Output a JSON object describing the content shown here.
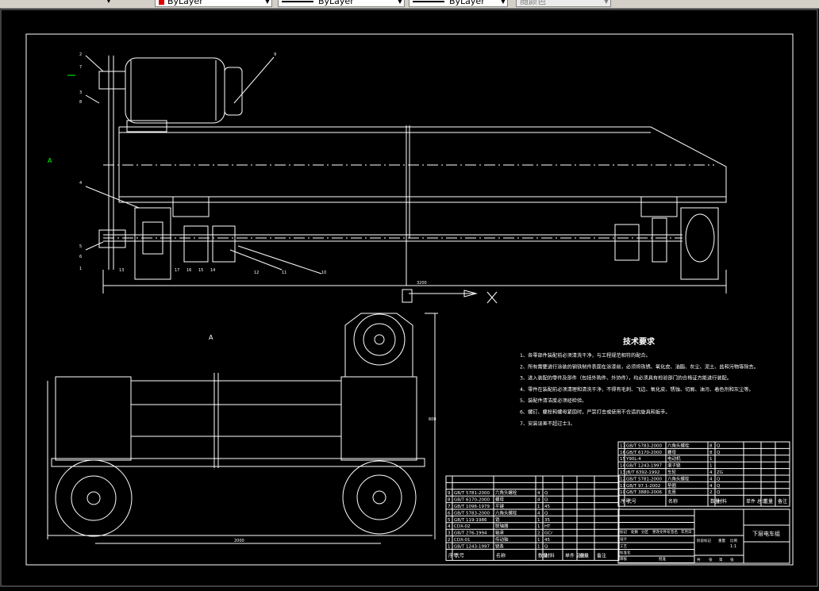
{
  "toolbar": {
    "layer_icons": [
      "layer-states-icon",
      "layer-previous-icon"
    ],
    "color_select": {
      "value": "ByLayer",
      "color": "#e00000"
    },
    "linetype_select": {
      "value": "ByLayer"
    },
    "lineweight_select": {
      "value": "ByLayer"
    },
    "plotstyle_select": {
      "value": "随颜色"
    }
  },
  "drawing": {
    "background": "#000000",
    "line_color": "#ffffff",
    "accent_color": "#00ff00",
    "view_label_top": "A",
    "view_label_section": "A",
    "dimension_total": "3200",
    "dimension_bottom": "2000",
    "dimension_side": "600",
    "balloons": [
      "2",
      "7",
      "3",
      "8",
      "9",
      "4",
      "5",
      "6",
      "1",
      "13",
      "12",
      "17",
      "16",
      "15",
      "14",
      "11",
      "10"
    ],
    "tech_req": {
      "title": "技术要求",
      "items": [
        "1、各零部件装配前必须清洗干净，与工程规范相符的配合。",
        "2、所有需要进行涂装的钢铁制件表面在涂漆前，必须将铁锈、氧化皮、油脂、灰尘、泥土、盐和污物等除去。",
        "3、进入装配的零件及部件（包括外购件、外协件），均必须具有检验部门的合格证方能进行装配。",
        "4、零件在装配前必须清理和清洗干净，不得有毛刺、飞边、氧化皮、锈蚀、切屑、油污、着色剂和灰尘等。",
        "5、装配件清洁度必须经检验。",
        "6、螺钉、螺栓和螺母紧固时，严禁打击或使用不合适的旋具和扳手。",
        "7、安装误差不超过士3。"
      ]
    },
    "bom_left": {
      "headers": [
        "序号",
        "代号",
        "名称",
        "数量",
        "材料",
        "单件 总计",
        "重量",
        "备注"
      ],
      "rows": [
        [
          "9",
          "GB/T 5781-2000",
          "六角头螺栓",
          "4",
          "Q"
        ],
        [
          "8",
          "GB/T 6170-2000",
          "螺母",
          "4",
          "Q"
        ],
        [
          "7",
          "GB/T 1096-1979",
          "平键",
          "1",
          "45"
        ],
        [
          "6",
          "GB/T 5783-2000",
          "六角头螺栓",
          "4",
          "Q"
        ],
        [
          "5",
          "GB/T 119-1986",
          "销",
          "1",
          "35"
        ],
        [
          "4",
          "CDX-02",
          "联轴器",
          "1",
          "HT"
        ],
        [
          "3",
          "GB/T 276-1994",
          "轴承",
          "2",
          "GCr"
        ],
        [
          "2",
          "CDX-01",
          "传动轴",
          "1",
          "45"
        ],
        [
          "1",
          "GB/T 1243-1997",
          "链条",
          "1",
          "Q"
        ]
      ]
    },
    "bom_right": {
      "headers": [
        "序号",
        "代号",
        "名称",
        "数量",
        "材料",
        "单件 总计",
        "重量",
        "备注"
      ],
      "rows": [
        [
          "17",
          "GB/T 5783-2000",
          "六角头螺栓",
          "8",
          "Q"
        ],
        [
          "16",
          "GB/T 6170-2000",
          "螺母",
          "8",
          "Q"
        ],
        [
          "15",
          "Y90L-4",
          "电动机",
          "1",
          ""
        ],
        [
          "14",
          "GB/T 1243-1997",
          "滚子链",
          "1",
          ""
        ],
        [
          "13",
          "JB/T 6392-1992",
          "车轮",
          "4",
          "ZG"
        ],
        [
          "12",
          "GB/T 5781-2000",
          "六角头螺栓",
          "4",
          "Q"
        ],
        [
          "11",
          "GB/T 97.1-2002",
          "垫圈",
          "4",
          "Q"
        ],
        [
          "10",
          "GB/T 3880-2006",
          "支座",
          "2",
          "Q"
        ]
      ]
    },
    "title_block": {
      "drawing_title": "下层电车组",
      "labels": [
        "标记",
        "处数",
        "分区",
        "更改文件号",
        "签名",
        "年月日",
        "设计",
        "标准化",
        "审核",
        "工艺",
        "批准",
        "阶段标记",
        "重量",
        "比例",
        "共",
        "张",
        "第",
        "张"
      ],
      "scale": "1:1"
    }
  }
}
